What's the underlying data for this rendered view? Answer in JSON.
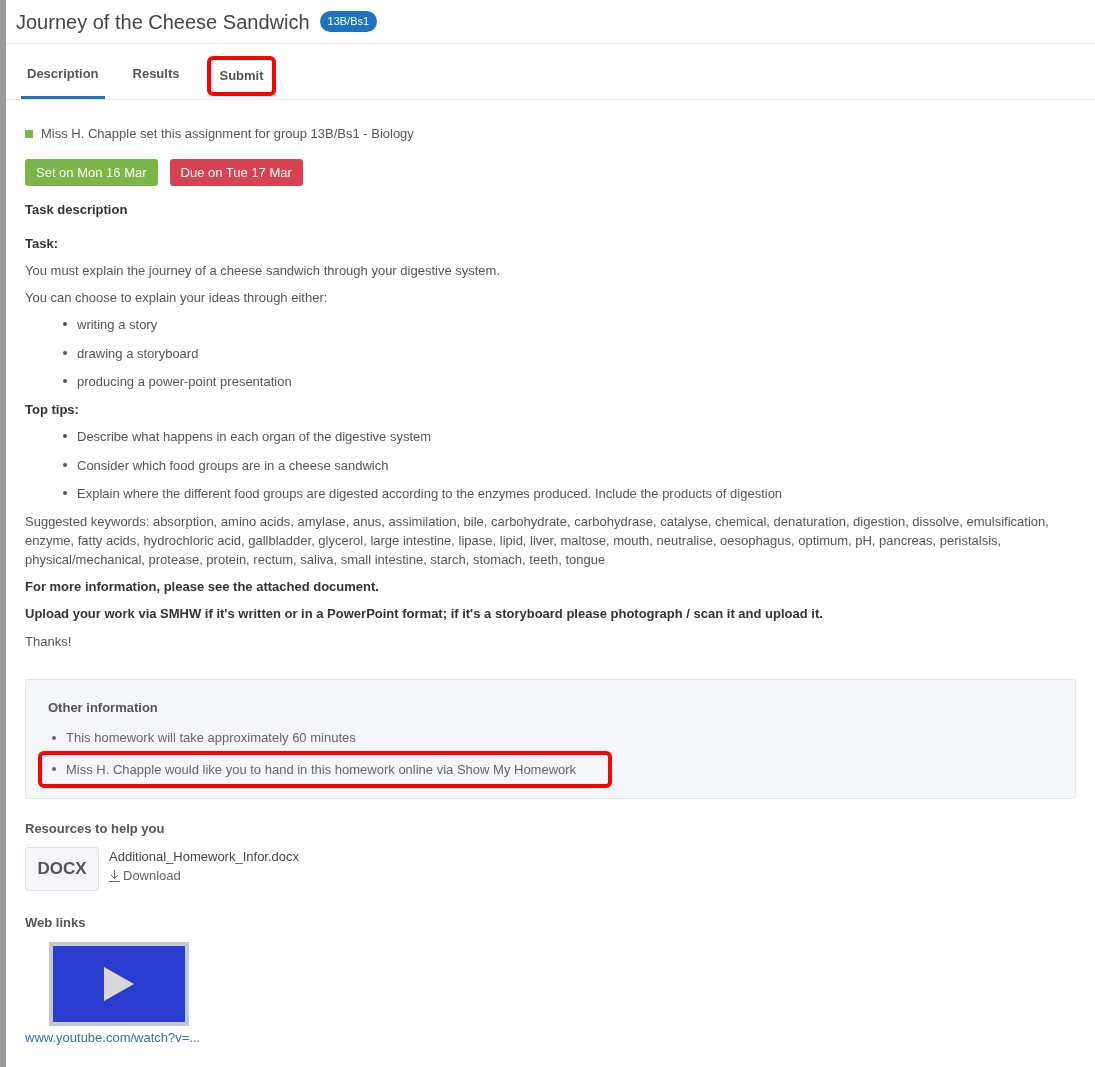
{
  "header": {
    "title": "Journey of the Cheese Sandwich",
    "badge": "13B/Bs1"
  },
  "tabs": [
    {
      "label": "Description",
      "selected": true,
      "highlighted": false
    },
    {
      "label": "Results",
      "selected": false,
      "highlighted": false
    },
    {
      "label": "Submit",
      "selected": false,
      "highlighted": true
    }
  ],
  "setter": "Miss H. Chapple set this assignment for group 13B/Bs1 - Biology",
  "dates": [
    {
      "label": "Set on Mon 16 Mar",
      "color": "#7ab648"
    },
    {
      "label": "Due on Tue 17 Mar",
      "color": "#d9434f"
    }
  ],
  "description": [
    {
      "kind": "heading",
      "text": "Task description"
    },
    {
      "kind": "bold",
      "text": "Task:"
    },
    {
      "kind": "text",
      "text": "You must explain the journey of a cheese sandwich through your digestive system."
    },
    {
      "kind": "text",
      "text": "You can choose to explain your ideas through either:"
    },
    {
      "kind": "list",
      "items": [
        "writing a story",
        "drawing a storyboard",
        "producing a power-point presentation"
      ]
    },
    {
      "kind": "bold",
      "text": "Top tips:"
    },
    {
      "kind": "list",
      "items": [
        "Describe what happens in each organ of the digestive system",
        "Consider which food groups are in a cheese sandwich",
        "Explain where the different food groups are digested according to the enzymes produced.  Include the products of digestion"
      ]
    },
    {
      "kind": "text",
      "text": "Suggested keywords: absorption, amino acids, amylase, anus, assimilation, bile, carbohydrate, carbohydrase, catalyse, chemical, denaturation, digestion, dissolve, emulsification, enzyme, fatty acids, hydrochloric acid, gallbladder, glycerol, large intestine, lipase, lipid, liver, maltose, mouth, neutralise, oesophagus, optimum, pH, pancreas, peristalsis, physical/mechanical, protease, protein, rectum, saliva, small intestine, starch, stomach, teeth, tongue"
    },
    {
      "kind": "bold",
      "text": "For more information, please see the attached document."
    },
    {
      "kind": "bold",
      "text": "Upload your work via SMHW if it's written or in a PowerPoint format; if it's a storyboard please photograph / scan it and upload it."
    },
    {
      "kind": "text",
      "text": "Thanks!"
    }
  ],
  "other_information": {
    "title": "Other information",
    "items": [
      {
        "text": "This homework will take approximately 60 minutes",
        "highlighted": false
      },
      {
        "text": "Miss H. Chapple would like you to hand in this homework online via Show My Homework",
        "highlighted": true
      }
    ]
  },
  "resources": {
    "title": "Resources to help you",
    "files": [
      {
        "type": "DOCX",
        "name": "Additional_Homework_Infor.docx",
        "action": "Download"
      }
    ]
  },
  "web_links": {
    "title": "Web links",
    "links": [
      {
        "url": "www.youtube.com/watch?v=..."
      }
    ]
  }
}
